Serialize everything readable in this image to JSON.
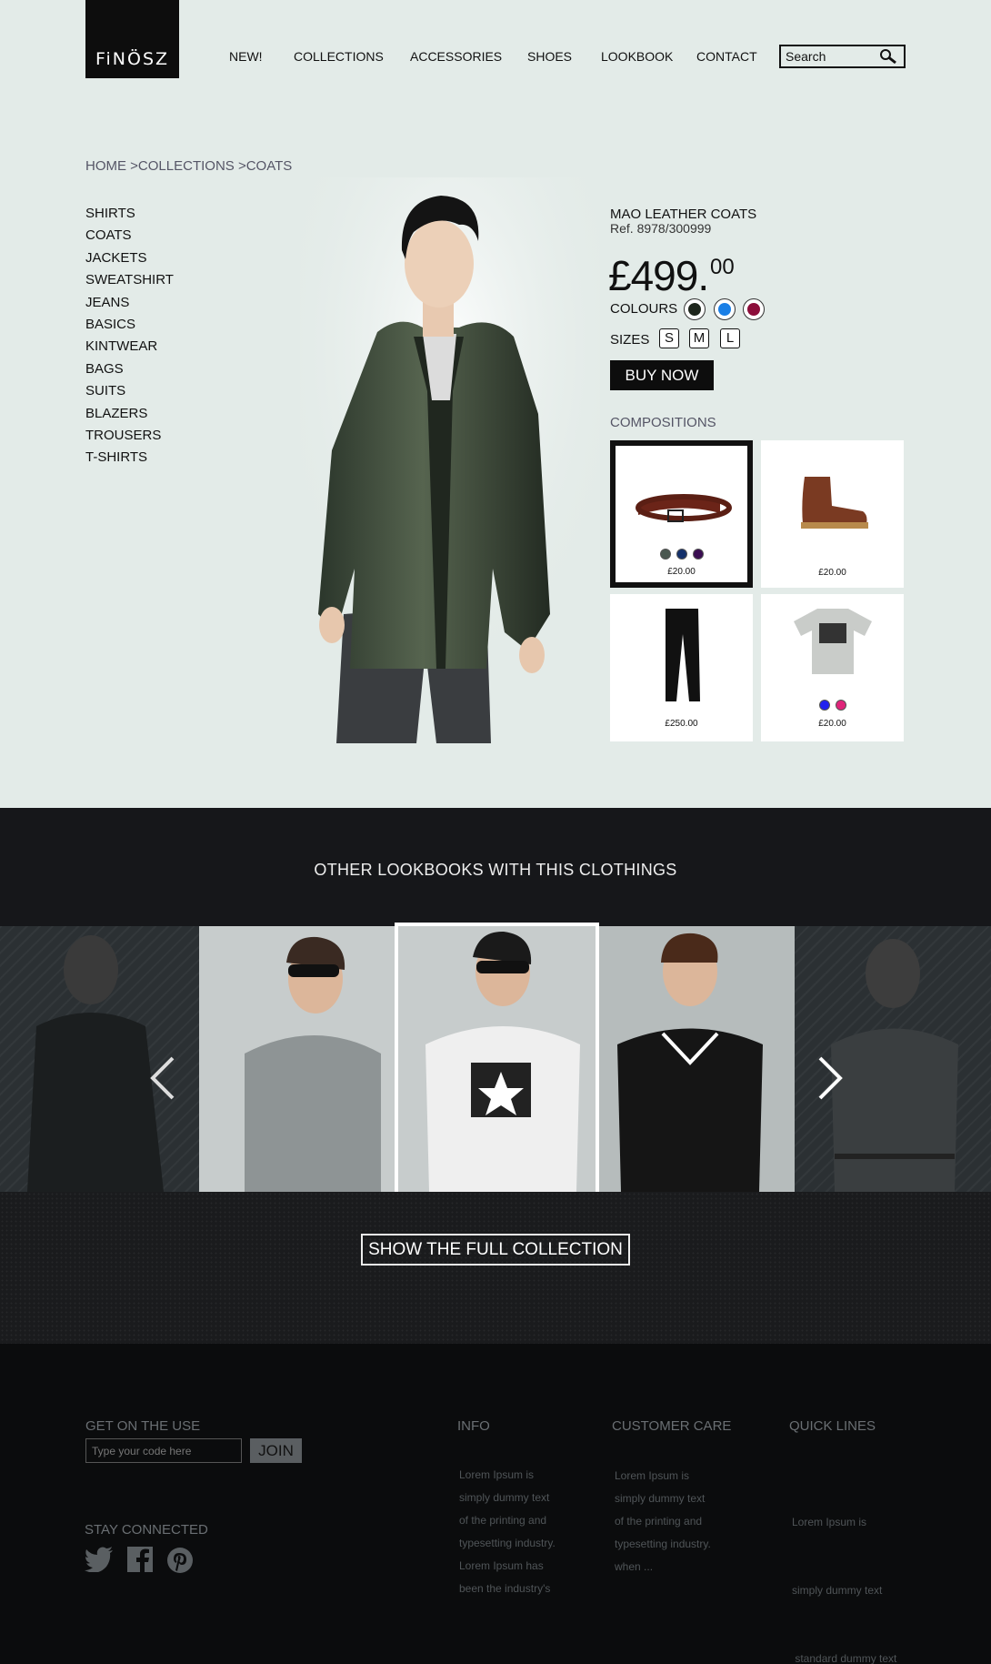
{
  "brand": {
    "logo_text": "FiNÖSZ"
  },
  "nav": {
    "items": [
      "NEW!",
      "COLLECTIONS",
      "ACCESSORIES",
      "SHOES",
      "LOOKBOOK",
      "CONTACT"
    ],
    "search_placeholder": "Search"
  },
  "breadcrumb": {
    "home": "HOME",
    "collections": ">COLLECTIONS",
    "current": ">COATS"
  },
  "categories": [
    "SHIRTS",
    "COATS",
    "JACKETS",
    "SWEATSHIRT",
    "JEANS",
    "BASICS",
    "KINTWEAR",
    "BAGS",
    "SUITS",
    "BLAZERS",
    "TROUSERS",
    "T-SHIRTS"
  ],
  "product": {
    "name": "MAO LEATHER COATS",
    "ref": "Ref. 8978/300999",
    "price": "£499.",
    "price_cents": "00",
    "colours_label": "COLOURS",
    "colours": [
      "#1e261c",
      "#1a7fe6",
      "#8c0d3a"
    ],
    "sizes_label": "SIZES",
    "sizes": [
      "S",
      "M",
      "L"
    ],
    "buy_label": "BUY NOW"
  },
  "compositions": {
    "title": "COMPOSITIONS",
    "items": [
      {
        "name": "belt",
        "price": "£20.00",
        "colors": [
          "#4a5750",
          "#13306b",
          "#3a0d52"
        ],
        "selected": true
      },
      {
        "name": "boot",
        "price": "£20.00",
        "colors": [],
        "selected": false
      },
      {
        "name": "jeans",
        "price": "£250.00",
        "colors": [],
        "selected": false
      },
      {
        "name": "t-shirt",
        "price": "£20.00",
        "colors": [
          "#2222ee",
          "#e0247a"
        ],
        "selected": false
      }
    ]
  },
  "lookbook": {
    "title": "OTHER LOOKBOOKS WITH THIS CLOTHINGS",
    "button_label": "SHOW THE FULL COLLECTION"
  },
  "footer": {
    "newsletter_title": "GET ON THE USE",
    "code_placeholder": "Type your code here",
    "join_label": "JOIN",
    "stay_connected": "STAY CONNECTED",
    "info_title": "INFO",
    "info_lines": [
      "Lorem Ipsum is",
      "simply dummy text",
      "of the printing and",
      "typesetting industry.",
      "Lorem Ipsum has",
      "been the industry's"
    ],
    "care_title": "CUSTOMER CARE",
    "care_lines": [
      "Lorem Ipsum is",
      "simply dummy text",
      "of the printing and",
      "typesetting industry.",
      "when ..."
    ],
    "quick_title": "QUICK LINES",
    "quick_lines": [
      "Lorem Ipsum is",
      "simply dummy text",
      " standard dummy text"
    ]
  }
}
